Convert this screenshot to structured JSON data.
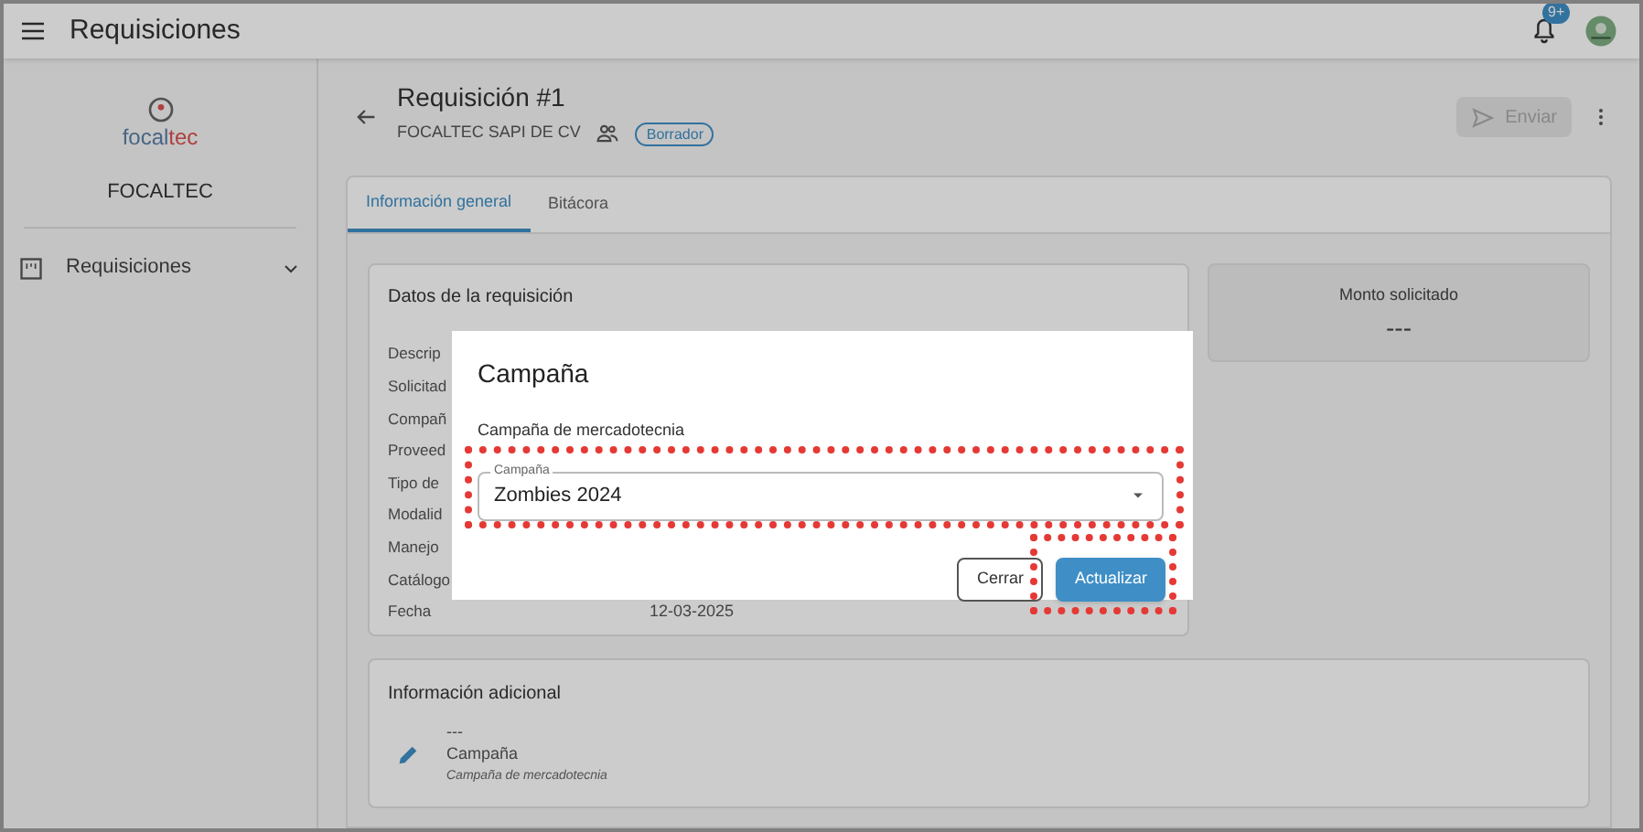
{
  "app_bar": {
    "title": "Requisiciones",
    "notification_badge": "9+"
  },
  "sidebar": {
    "logo_parts": [
      "focal",
      "tec"
    ],
    "company": "FOCALTEC",
    "items": [
      {
        "label": "Requisiciones",
        "expanded": false
      }
    ]
  },
  "header": {
    "title": "Requisición #1",
    "company": "FOCALTEC SAPI DE CV",
    "status": "Borrador",
    "send_button": {
      "label": "Enviar",
      "disabled": true
    }
  },
  "tabs": [
    {
      "label": "Información general",
      "selected": true
    },
    {
      "label": "Bitácora",
      "selected": false
    }
  ],
  "details": {
    "title": "Datos de la requisición",
    "rows": [
      {
        "label": "Descrip"
      },
      {
        "label": "Solicitad"
      },
      {
        "label": "Compañ"
      },
      {
        "label": "Proveed"
      },
      {
        "label": "Tipo de"
      },
      {
        "label": "Modalid"
      },
      {
        "label": "Manejo"
      },
      {
        "label": "Catálogo"
      },
      {
        "label": "Fecha",
        "value": "12-03-2025"
      }
    ]
  },
  "amount": {
    "label": "Monto solicitado",
    "value": "---"
  },
  "additional": {
    "title": "Información adicional",
    "items": [
      {
        "value": "---",
        "label": "Campaña",
        "description": "Campaña de mercadotecnia"
      }
    ]
  },
  "dialog": {
    "title": "Campaña",
    "subtitle": "Campaña de mercadotecnia",
    "select": {
      "label": "Campaña",
      "value": "Zombies 2024"
    },
    "buttons": [
      {
        "label": "Cerrar",
        "kind": "outlined"
      },
      {
        "label": "Actualizar",
        "kind": "primary"
      }
    ]
  }
}
